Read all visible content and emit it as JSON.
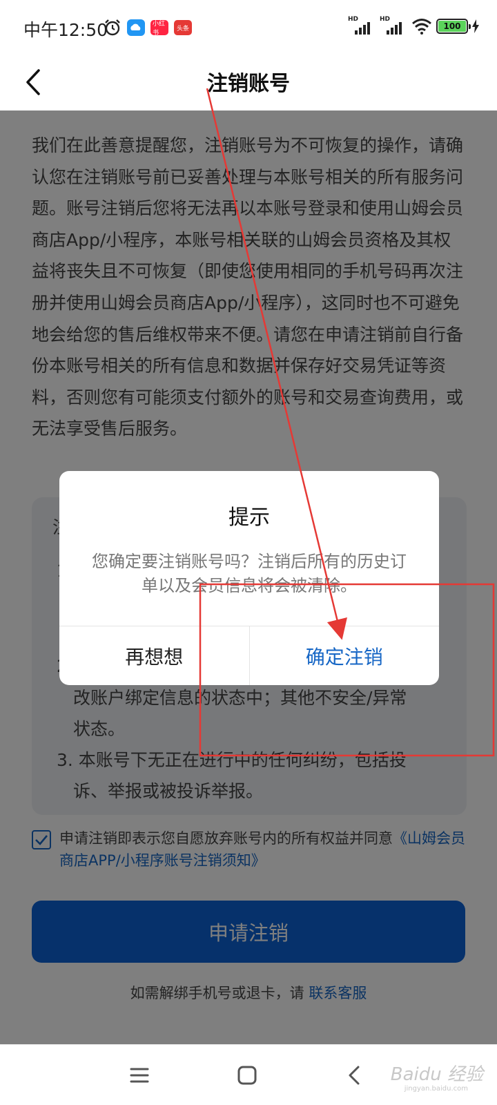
{
  "status_bar": {
    "time": "中午12:50",
    "app_badge_1": "小红书",
    "app_badge_2": "头条",
    "battery": "100",
    "hd_1": "HD",
    "hd_2": "HD"
  },
  "nav": {
    "title": "注销账号"
  },
  "intro_text": "我们在此善意提醒您，注销账号为不可恢复的操作，请确认您在注销账号前已妥善处理与本账号相关的所有服务问题。账号注销后您将无法再以本账号登录和使用山姆会员商店App/小程序，本账号相关联的山姆会员资格及其权益将丧失且不可恢复（即使您使用相同的手机号码再次注册并使用山姆会员商店App/小程序），这同时也不可避免地会给您的售后维权带来不便。请您在申请注销前自行备份本账号相关的所有信息和数据并保存好交易凭证等资料，否则您有可能须支付额外的账号和交易查询费用，或无法享受售后服务。",
  "conditions": {
    "title": "注",
    "item1": "1",
    "item2_prefix": "2",
    "item2_line1": "改账户绑定信息的状态中；其他不安全/异常",
    "item2_line2": "状态。",
    "item3_line1": "3. 本账号下无正在进行中的任何纠纷，包括投",
    "item3_line2": "诉、举报或被投诉举报。"
  },
  "agreement": {
    "text": "申请注销即表示您自愿放弃账号内的所有权益并同意",
    "link": "《山姆会员商店APP/小程序账号注销须知》"
  },
  "apply_button": "申请注销",
  "help": {
    "text": "如需解绑手机号或退卡，请",
    "link": "联系客服"
  },
  "dialog": {
    "title": "提示",
    "message": "您确定要注销账号吗？注销后所有的历史订单以及会员信息将会被清除。",
    "cancel": "再想想",
    "confirm": "确定注销"
  },
  "watermark": {
    "logo": "Baidu 经验",
    "sub": "jingyan.baidu.com"
  },
  "colors": {
    "accent": "#1666c5",
    "primary_button": "#0d62d6",
    "annotation": "#e53935"
  }
}
